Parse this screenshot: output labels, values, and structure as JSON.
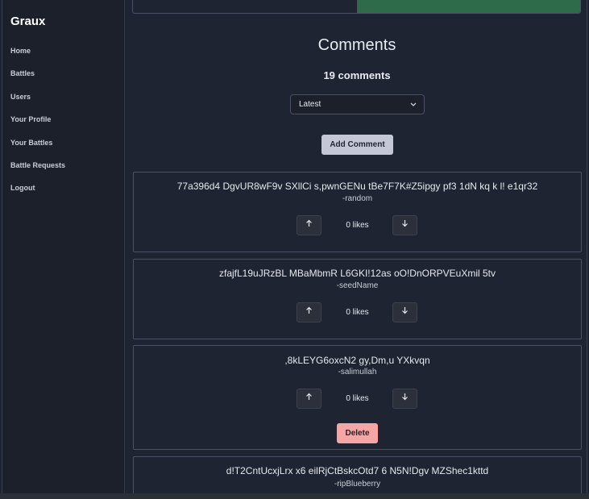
{
  "app": {
    "brand": "Graux"
  },
  "sidebar": {
    "items": [
      {
        "label": "Home"
      },
      {
        "label": "Battles"
      },
      {
        "label": "Users"
      },
      {
        "label": "Your Profile"
      },
      {
        "label": "Your Battles"
      },
      {
        "label": "Battle Requests"
      },
      {
        "label": "Logout"
      }
    ]
  },
  "comments_section": {
    "title": "Comments",
    "count_label": "19 comments",
    "sort": {
      "selected": "Latest"
    },
    "add_label": "Add Comment",
    "delete_label": "Delete",
    "items": [
      {
        "text": "77a396d4 DgvUR8wF9v SXllCi s,pwnGENu tBe7F7K#Z5ipgy pf3 1dN kq k l! e1qr32",
        "author": "-random",
        "likes": "0 likes"
      },
      {
        "text": "zfajfL19uJRzBL MBaMbmR L6GKI!12as oO!DnORPVEuXmil 5tv",
        "author": "-seedName",
        "likes": "0 likes"
      },
      {
        "text": ",8kLEYG6oxcN2 gy,Dm,u YXkvqn",
        "author": "-salimullah",
        "likes": "0 likes"
      },
      {
        "text": "d!T2CntUcxjLrx x6 eilRjCtBskcOtd7 6 N5N!Dgv MZShec1kttd",
        "author": "-ripBlueberry"
      }
    ]
  }
}
